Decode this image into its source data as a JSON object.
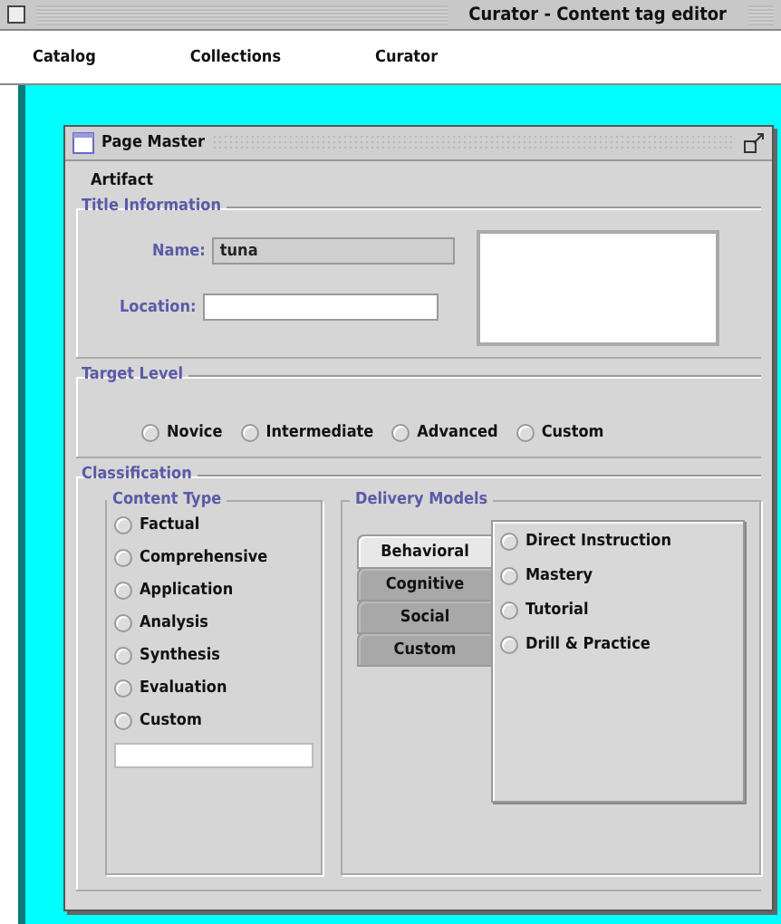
{
  "app_window": {
    "title": "Curator - Content tag editor"
  },
  "menu": [
    "Catalog",
    "Collections",
    "Curator"
  ],
  "document_window": {
    "title": "Page Master",
    "section": "Artifact"
  },
  "title_information": {
    "legend": "Title Information",
    "name_label": "Name:",
    "name_value": "tuna",
    "location_label": "Location:"
  },
  "target_level": {
    "legend": "Target Level",
    "options": [
      {
        "label": "Novice",
        "selected": false
      },
      {
        "label": "Intermediate",
        "selected": false
      },
      {
        "label": "Advanced",
        "selected": false
      },
      {
        "label": "Custom",
        "selected": false
      }
    ]
  },
  "classification": {
    "legend": "Classification",
    "content_type": {
      "legend": "Content Type",
      "options": [
        {
          "label": "Factual",
          "selected": false
        },
        {
          "label": "Comprehensive",
          "selected": false
        },
        {
          "label": "Application",
          "selected": false
        },
        {
          "label": "Analysis",
          "selected": false
        },
        {
          "label": "Synthesis",
          "selected": false
        },
        {
          "label": "Evaluation",
          "selected": false
        },
        {
          "label": "Custom",
          "selected": false
        }
      ]
    },
    "delivery_models": {
      "legend": "Delivery Models",
      "tabs": [
        {
          "label": "Behavioral",
          "selected": true
        },
        {
          "label": "Cognitive",
          "selected": false
        },
        {
          "label": "Social",
          "selected": false
        },
        {
          "label": "Custom",
          "selected": false
        }
      ],
      "options": [
        {
          "label": "Direct Instruction",
          "selected": false
        },
        {
          "label": "Mastery",
          "selected": false
        },
        {
          "label": "Tutorial",
          "selected": false
        },
        {
          "label": "Drill & Practice",
          "selected": false
        }
      ]
    }
  }
}
